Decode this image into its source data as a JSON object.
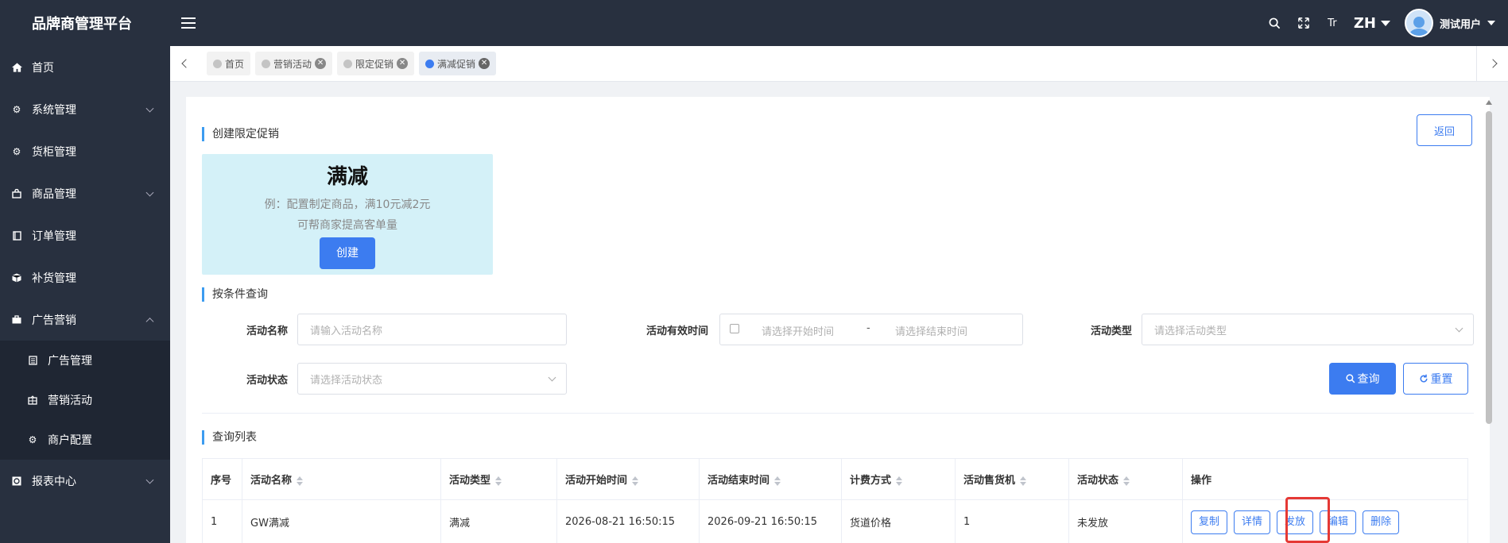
{
  "app": {
    "title": "品牌商管理平台"
  },
  "topbar": {
    "lang": "ZH",
    "font_icon": "Tr",
    "user_name": "测试用户"
  },
  "sidebar": {
    "items": [
      {
        "label": "首页",
        "icon": "home-icon"
      },
      {
        "label": "系统管理",
        "icon": "gear-icon"
      },
      {
        "label": "货柜管理",
        "icon": "gear-icon"
      },
      {
        "label": "商品管理",
        "icon": "bag-icon"
      },
      {
        "label": "订单管理",
        "icon": "document-icon"
      },
      {
        "label": "补货管理",
        "icon": "box-icon"
      },
      {
        "label": "广告营销",
        "icon": "briefcase-icon"
      },
      {
        "label": "广告管理",
        "icon": "list-icon"
      },
      {
        "label": "营销活动",
        "icon": "grid-icon"
      },
      {
        "label": "商户配置",
        "icon": "gear-icon"
      },
      {
        "label": "报表中心",
        "icon": "chart-icon"
      }
    ]
  },
  "tabs": [
    {
      "label": "首页"
    },
    {
      "label": "营销活动"
    },
    {
      "label": "限定促销"
    },
    {
      "label": "满减促销"
    }
  ],
  "page": {
    "create_title": "创建限定促销",
    "back_label": "返回",
    "promo": {
      "title": "满减",
      "desc1": "例：配置制定商品，满10元减2元",
      "desc2": "可帮商家提高客单量",
      "create_label": "创建"
    },
    "filter_title": "按条件查询",
    "filters": {
      "name_label": "活动名称",
      "name_placeholder": "请输入活动名称",
      "time_label": "活动有效时间",
      "start_placeholder": "请选择开始时间",
      "separator": "-",
      "end_placeholder": "请选择结束时间",
      "type_label": "活动类型",
      "type_placeholder": "请选择活动类型",
      "status_label": "活动状态",
      "status_placeholder": "请选择活动状态",
      "query_label": "查询",
      "reset_label": "重置"
    },
    "list_title": "查询列表",
    "table": {
      "headers": [
        "序号",
        "活动名称",
        "活动类型",
        "活动开始时间",
        "活动结束时间",
        "计费方式",
        "活动售货机",
        "活动状态",
        "操作"
      ],
      "rows": [
        {
          "index": "1",
          "name": "GW满减",
          "type": "满减",
          "start": "2026-08-21 16:50:15",
          "end": "2026-09-21 16:50:15",
          "billing": "货道价格",
          "machines": "1",
          "status": "未发放",
          "actions": [
            "复制",
            "详情",
            "发放",
            "编辑",
            "删除"
          ]
        }
      ]
    }
  }
}
